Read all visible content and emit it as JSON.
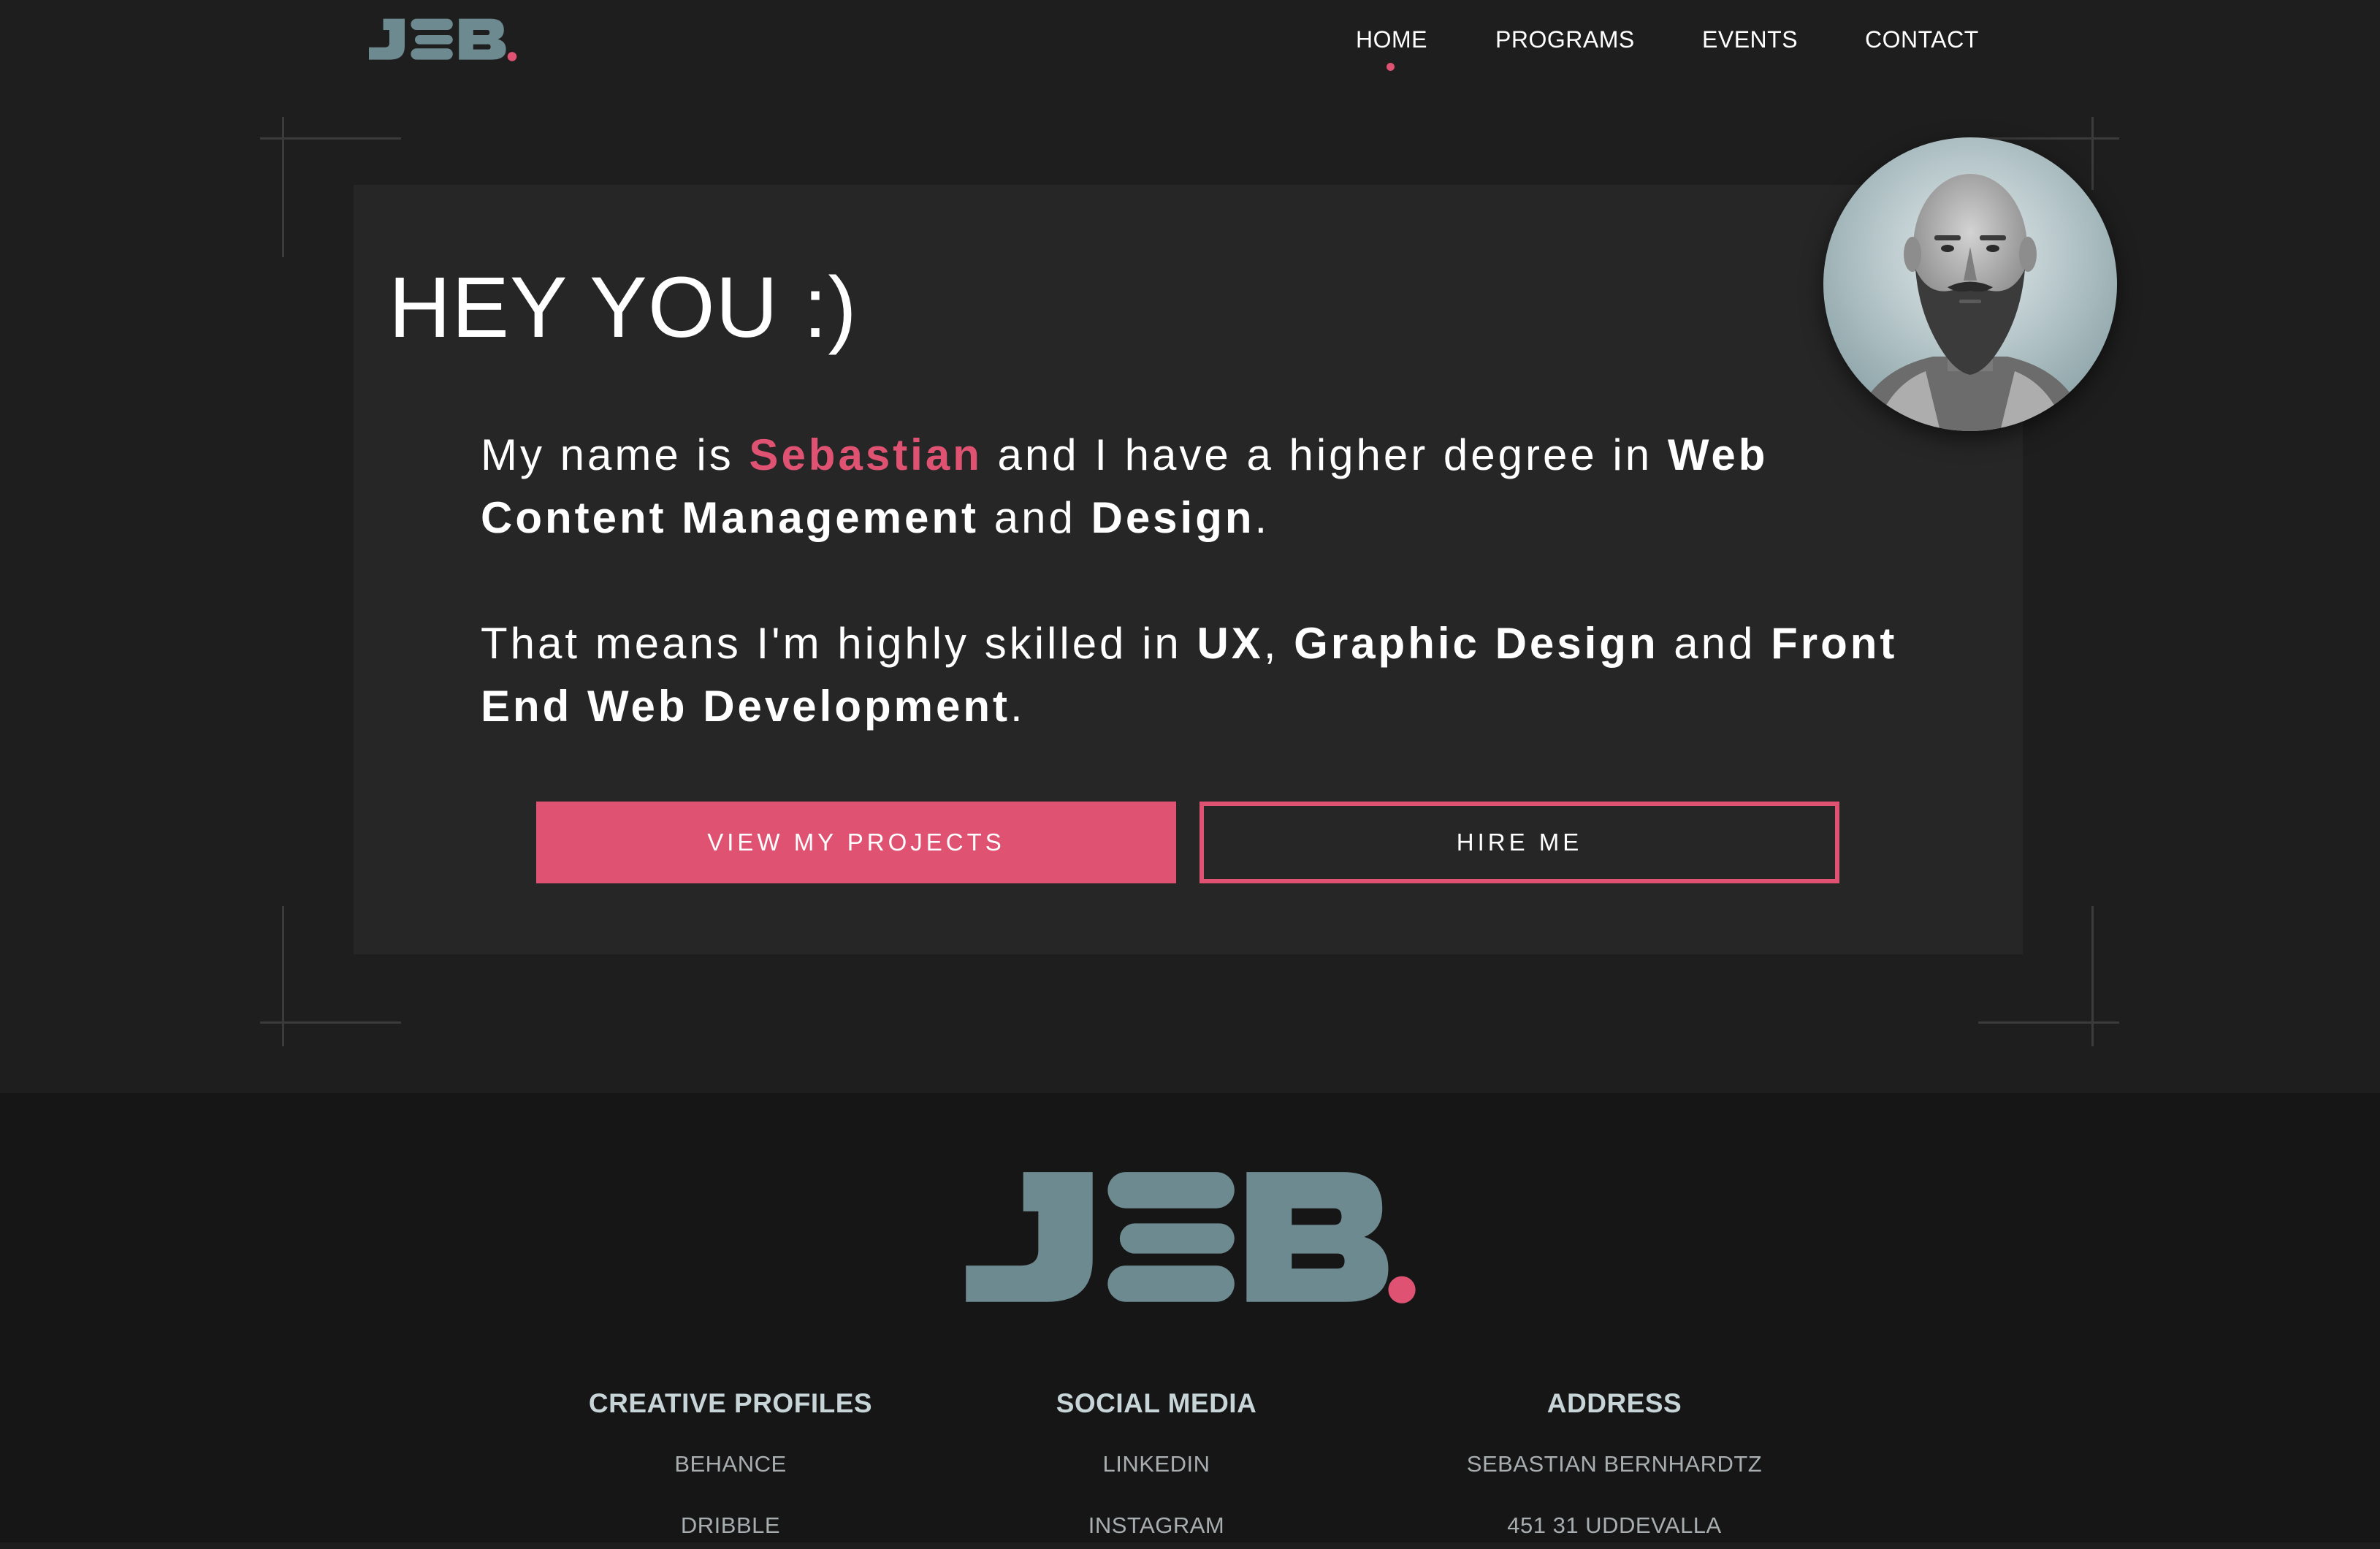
{
  "colors": {
    "accent": "#e05272",
    "logo": "#6d8a90",
    "background": "#1e1e1f",
    "card": "#262627",
    "footer": "#161617"
  },
  "header": {
    "logo_text": "JSB",
    "nav": [
      {
        "label": "HOME",
        "active": true
      },
      {
        "label": "PROGRAMS",
        "active": false
      },
      {
        "label": "EVENTS",
        "active": false
      },
      {
        "label": "CONTACT",
        "active": false
      }
    ]
  },
  "hero": {
    "title": "HEY YOU :)",
    "p1": {
      "t1": "My name is ",
      "name": "Sebastian",
      "t2": " and I have a higher degree in ",
      "b1": "Web Content Management",
      "t3": " and ",
      "b2": "Design",
      "t4": "."
    },
    "p2": {
      "t1": "That means I'm highly skilled in ",
      "b1": "UX",
      "t2": ", ",
      "b2": "Graphic Design",
      "t3": " and ",
      "b3": "Front End Web Development",
      "t4": "."
    },
    "primary_button": "VIEW MY PROJECTS",
    "secondary_button": "HIRE ME",
    "avatar_icon": "profile-photo"
  },
  "footer": {
    "logo_text": "JSB",
    "columns": [
      {
        "title": "CREATIVE PROFILES",
        "items": [
          "BEHANCE",
          "DRIBBLE"
        ]
      },
      {
        "title": "SOCIAL MEDIA",
        "items": [
          "LINKEDIN",
          "INSTAGRAM"
        ]
      },
      {
        "title": "ADDRESS",
        "items": [
          "SEBASTIAN BERNHARDTZ",
          "451 31 UDDEVALLA"
        ]
      }
    ]
  }
}
